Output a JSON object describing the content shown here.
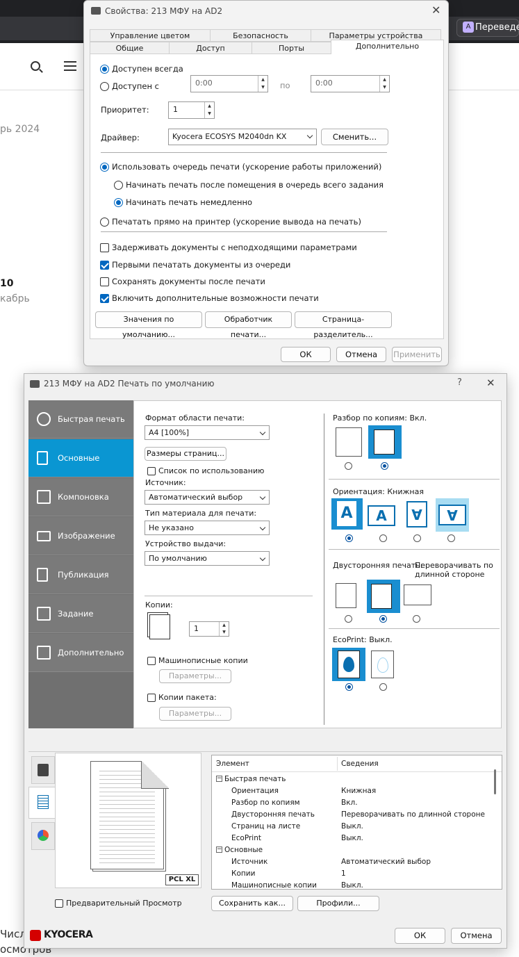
{
  "background": {
    "translate_button": "Переведе",
    "date_fragment": "рь 2024",
    "number_fragment": "10",
    "month_fragment": "кабрь",
    "bottom_fragment1": "Числ",
    "bottom_fragment2": "осмотров"
  },
  "props_dialog": {
    "title": "Свойства: 213 МФУ на AD2",
    "tabs_row1": [
      "Управление цветом",
      "Безопасность",
      "Параметры устройства"
    ],
    "tabs_row2": [
      "Общие",
      "Доступ",
      "Порты",
      "Дополнительно"
    ],
    "avail_always": "Доступен всегда",
    "avail_from": "Доступен с",
    "time_from": "0:00",
    "time_to_label": "по",
    "time_to": "0:00",
    "priority_label": "Приоритет:",
    "priority_value": "1",
    "driver_label": "Драйвер:",
    "driver_value": "Kyocera ECOSYS M2040dn KX",
    "change_button": "Сменить...",
    "spool": "Использовать очередь печати (ускорение работы приложений)",
    "spool_after": "Начинать печать после помещения в очередь всего задания",
    "spool_immediate": "Начинать печать немедленно",
    "direct": "Печатать прямо на принтер (ускорение вывода на печать)",
    "hold_mismatched": "Задерживать документы с неподходящими параметрами",
    "spooled_first": "Первыми печатать документы из очереди",
    "keep_printed": "Сохранять документы после печати",
    "advanced_features": "Включить дополнительные возможности печати",
    "defaults_button": "Значения по умолчанию...",
    "processor_button": "Обработчик печати...",
    "separator_button": "Страница-разделитель...",
    "ok": "ОК",
    "cancel": "Отмена",
    "apply": "Применить"
  },
  "print_dialog": {
    "title": "213 МФУ на AD2 Печать по умолчанию",
    "help": "?",
    "nav": [
      "Быстрая печать",
      "Основные",
      "Компоновка",
      "Изображение",
      "Публикация",
      "Задание",
      "Дополнительно"
    ],
    "page_size_label": "Формат области печати:",
    "page_size_value": "A4  [100%]",
    "page_sizes_button": "Размеры страниц...",
    "list_by_use": "Список по использованию",
    "source_label": "Источник:",
    "source_value": "Автоматический выбор",
    "media_label": "Тип материала для печати:",
    "media_value": "Не указано",
    "output_label": "Устройство выдачи:",
    "output_value": "По умолчанию",
    "copies_label": "Копии:",
    "copies_value": "1",
    "mopy": "Машинописные копии",
    "params1": "Параметры...",
    "batch": "Копии пакета:",
    "params2": "Параметры...",
    "collate_label": "Разбор по копиям:",
    "collate_value": "Вкл.",
    "orientation_label": "Ориентация:",
    "orientation_value": "Книжная",
    "duplex_label": "Двусторонняя печать:",
    "duplex_value": "Переворачивать по длинной стороне",
    "eco_label": "EcoPrint:",
    "eco_value": "Выкл.",
    "pclxl": "PCL XL",
    "preview": "Предварительный Просмотр",
    "save_as": "Сохранить как...",
    "profiles": "Профили...",
    "table_headers": [
      "Элемент",
      "Сведения"
    ],
    "table_rows": [
      {
        "item": "Быстрая печать",
        "value": "",
        "group": true
      },
      {
        "item": "Ориентация",
        "value": "Книжная"
      },
      {
        "item": "Разбор по копиям",
        "value": "Вкл."
      },
      {
        "item": "Двусторонняя печать",
        "value": "Переворачивать по длинной стороне"
      },
      {
        "item": "Страниц на листе",
        "value": "Выкл."
      },
      {
        "item": "EcoPrint",
        "value": "Выкл."
      },
      {
        "item": "Основные",
        "value": "",
        "group": true
      },
      {
        "item": "Источник",
        "value": "Автоматический выбор"
      },
      {
        "item": "Копии",
        "value": "1"
      },
      {
        "item": "Машинописные копии",
        "value": "Выкл."
      }
    ],
    "brand": "KYOCERA",
    "ok": "ОК",
    "cancel": "Отмена"
  },
  "colors": {
    "accent": "#0067c0",
    "nav_selected": "#0a96d2",
    "icon_blue": "#1a8ed0"
  }
}
